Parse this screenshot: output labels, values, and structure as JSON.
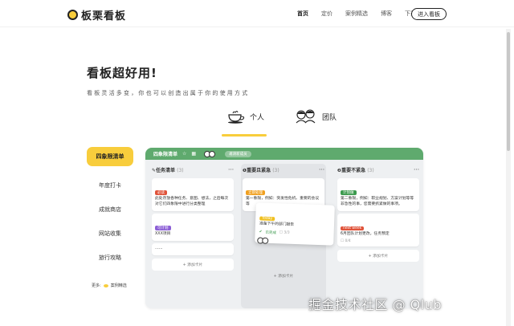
{
  "nav": {
    "logo_text": "板栗看板",
    "links": [
      "首页",
      "定价",
      "案例精选",
      "博客",
      "下载"
    ],
    "enter_button": "进入看板"
  },
  "hero": {
    "title": "看板超好用!",
    "subtitle": "看板灵活多变，你也可以创造出属于你的使用方式"
  },
  "mode_tabs": [
    {
      "label": "个人",
      "icon": "teacup-icon"
    },
    {
      "label": "团队",
      "icon": "team-icon"
    }
  ],
  "side_menu": {
    "items": [
      "四象限清单",
      "年度打卡",
      "成就商店",
      "网站收集",
      "旅行攻略"
    ],
    "more_label": "更多:",
    "more_link": "案例精选"
  },
  "board": {
    "name": "四象限清单",
    "invite": "邀请新成员",
    "colors": {
      "header": "#5faa6e",
      "accent": "#f8cd3c"
    },
    "columns": [
      {
        "title": "✎任务清单",
        "count": "(3)",
        "cards": [
          {
            "tag": "必读",
            "tag_color": "#e0533a",
            "text": "此处存放各种任务、意图、想法，之后每次对它们四象限中进行分类整理"
          },
          {
            "tag": "可计划",
            "tag_color": "#8c5fd6",
            "text": "XXX项目"
          },
          {
            "tag": "",
            "text": "……"
          }
        ],
        "add_label": "+ 添加卡片"
      },
      {
        "title": "❶重要且紧急",
        "count": "(3)",
        "cards": [
          {
            "tag": "立即处理",
            "tag_color": "#f0a020",
            "text": "第一象限，例如：突发性危机、重要的会议等"
          }
        ],
        "add_label": "+ 添加卡片"
      },
      {
        "title": "❷重要不紧急",
        "count": "(3)",
        "cards": [
          {
            "tag": "计划做",
            "tag_color": "#3c9a4e",
            "text": "第二象限，例如：职业规划、方案计划等等非急性的事，您需要抓紧做的事项。"
          },
          {
            "tag": "next week",
            "tag_color": "#e0533a",
            "text": "6月团队计划更改，任务预定",
            "meta": "☐ 0/4"
          }
        ],
        "add_label": "+ 添加卡片"
      }
    ],
    "float_card": {
      "tag": "Today",
      "tag_color": "#f0c020",
      "text": "准备下午的部门报告",
      "status": "已完成",
      "meta": "☐ 3/3"
    }
  },
  "watermark": "掘金技术社区 @ Qlub"
}
